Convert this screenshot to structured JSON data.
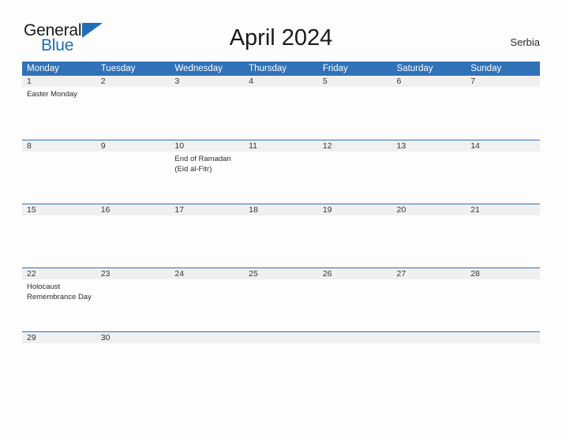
{
  "brand": {
    "name_part1": "General",
    "name_part2": "Blue",
    "triangle_icon": "triangle-icon",
    "color_primary": "#1d6fb8"
  },
  "header": {
    "title": "April 2024",
    "region": "Serbia",
    "header_bg_color": "#2f72b8",
    "band_color": "#f0f0f0"
  },
  "calendar": {
    "weekdays": [
      "Monday",
      "Tuesday",
      "Wednesday",
      "Thursday",
      "Friday",
      "Saturday",
      "Sunday"
    ],
    "weeks": [
      {
        "days": [
          {
            "date": "1",
            "events": [
              "Easter Monday"
            ]
          },
          {
            "date": "2",
            "events": []
          },
          {
            "date": "3",
            "events": []
          },
          {
            "date": "4",
            "events": []
          },
          {
            "date": "5",
            "events": []
          },
          {
            "date": "6",
            "events": []
          },
          {
            "date": "7",
            "events": []
          }
        ]
      },
      {
        "days": [
          {
            "date": "8",
            "events": []
          },
          {
            "date": "9",
            "events": []
          },
          {
            "date": "10",
            "events": [
              "End of Ramadan",
              "(Eid al-Fitr)"
            ]
          },
          {
            "date": "11",
            "events": []
          },
          {
            "date": "12",
            "events": []
          },
          {
            "date": "13",
            "events": []
          },
          {
            "date": "14",
            "events": []
          }
        ]
      },
      {
        "days": [
          {
            "date": "15",
            "events": []
          },
          {
            "date": "16",
            "events": []
          },
          {
            "date": "17",
            "events": []
          },
          {
            "date": "18",
            "events": []
          },
          {
            "date": "19",
            "events": []
          },
          {
            "date": "20",
            "events": []
          },
          {
            "date": "21",
            "events": []
          }
        ]
      },
      {
        "days": [
          {
            "date": "22",
            "events": [
              "Holocaust",
              "Remembrance Day"
            ]
          },
          {
            "date": "23",
            "events": []
          },
          {
            "date": "24",
            "events": []
          },
          {
            "date": "25",
            "events": []
          },
          {
            "date": "26",
            "events": []
          },
          {
            "date": "27",
            "events": []
          },
          {
            "date": "28",
            "events": []
          }
        ]
      },
      {
        "days": [
          {
            "date": "29",
            "events": []
          },
          {
            "date": "30",
            "events": []
          },
          {
            "date": "",
            "events": []
          },
          {
            "date": "",
            "events": []
          },
          {
            "date": "",
            "events": []
          },
          {
            "date": "",
            "events": []
          },
          {
            "date": "",
            "events": []
          }
        ]
      }
    ]
  }
}
